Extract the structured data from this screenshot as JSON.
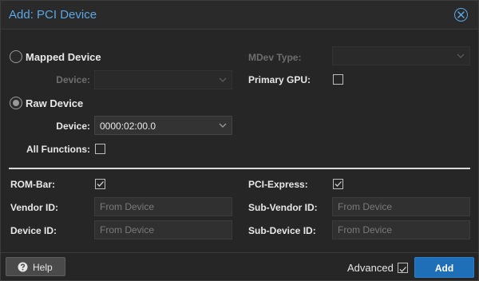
{
  "window": {
    "title": "Add: PCI Device",
    "close_icon": "close-circle-icon"
  },
  "mapped_device": {
    "radio_label": "Mapped Device",
    "selected": false,
    "device_label": "Device:",
    "device_value": ""
  },
  "mdev": {
    "label": "MDev Type:",
    "value": ""
  },
  "primary_gpu": {
    "label": "Primary GPU:",
    "checked": false
  },
  "raw_device": {
    "radio_label": "Raw Device",
    "selected": true,
    "device_label": "Device:",
    "device_value": "0000:02:00.0"
  },
  "all_functions": {
    "label": "All Functions:",
    "checked": false
  },
  "advanced": {
    "rom_bar_label": "ROM-Bar:",
    "rom_bar_checked": true,
    "pci_express_label": "PCI-Express:",
    "pci_express_checked": true,
    "vendor_id_label": "Vendor ID:",
    "vendor_id_placeholder": "From Device",
    "sub_vendor_id_label": "Sub-Vendor ID:",
    "sub_vendor_id_placeholder": "From Device",
    "device_id_label": "Device ID:",
    "device_id_placeholder": "From Device",
    "sub_device_id_label": "Sub-Device ID:",
    "sub_device_id_placeholder": "From Device"
  },
  "footer": {
    "help_label": "Help",
    "help_icon": "question-circle-icon",
    "advanced_label": "Advanced",
    "advanced_checked": true,
    "add_label": "Add"
  },
  "colors": {
    "accent": "#5aa8e6",
    "primary_button": "#1e6fb8",
    "background": "#262626"
  }
}
